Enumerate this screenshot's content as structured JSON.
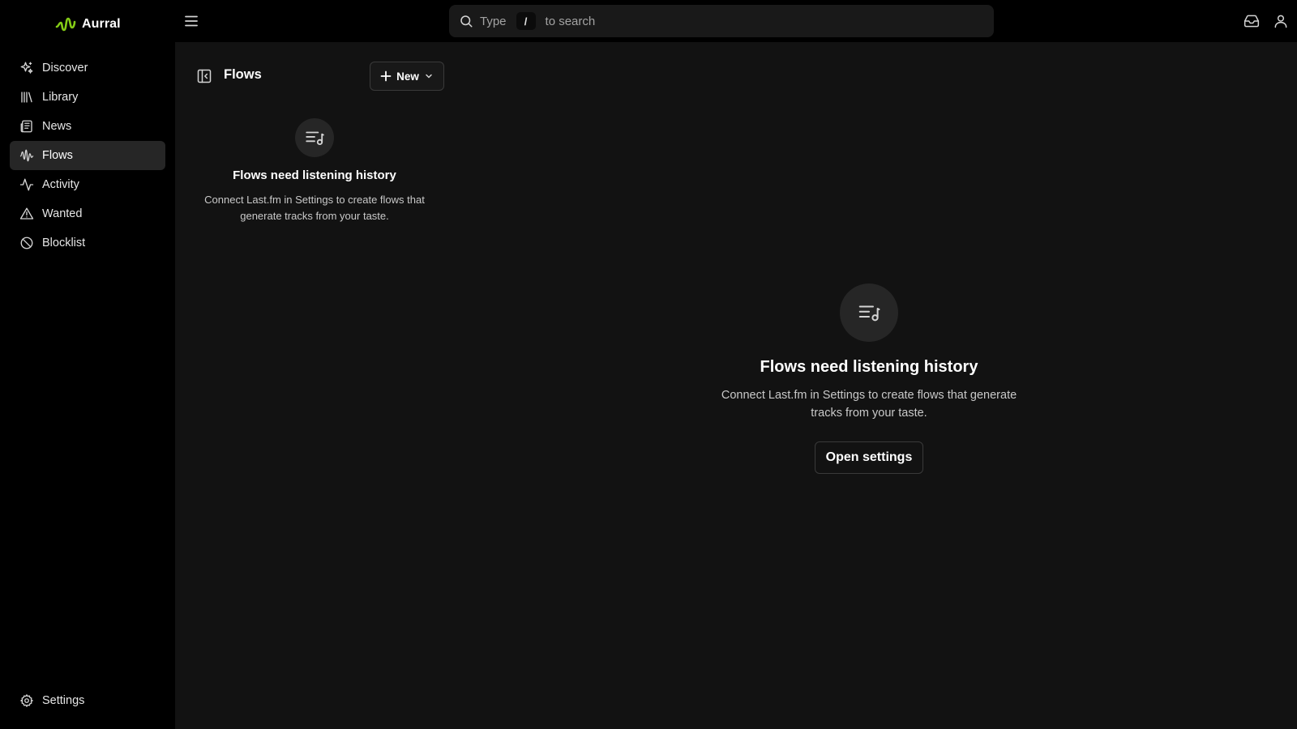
{
  "app": {
    "name": "Aurral",
    "accent": "#84cc16"
  },
  "sidebar": {
    "items": [
      {
        "label": "Discover",
        "icon": "sparkles-icon"
      },
      {
        "label": "Library",
        "icon": "library-icon"
      },
      {
        "label": "News",
        "icon": "newspaper-icon"
      },
      {
        "label": "Flows",
        "icon": "audio-waveform-icon",
        "active": true
      },
      {
        "label": "Activity",
        "icon": "activity-icon"
      },
      {
        "label": "Wanted",
        "icon": "alert-triangle-icon"
      },
      {
        "label": "Blocklist",
        "icon": "ban-icon"
      }
    ],
    "settings": {
      "label": "Settings",
      "icon": "gear-icon"
    }
  },
  "topbar": {
    "search": {
      "prefix": "Type",
      "key": "/",
      "suffix": "to search"
    }
  },
  "panel": {
    "title": "Flows",
    "new_label": "New",
    "empty": {
      "title": "Flows need listening history",
      "description": "Connect Last.fm in Settings to create flows that generate tracks from your taste."
    }
  },
  "main": {
    "empty": {
      "title": "Flows need listening history",
      "description": "Connect Last.fm in Settings to create flows that generate tracks from your taste.",
      "button_label": "Open settings"
    }
  }
}
